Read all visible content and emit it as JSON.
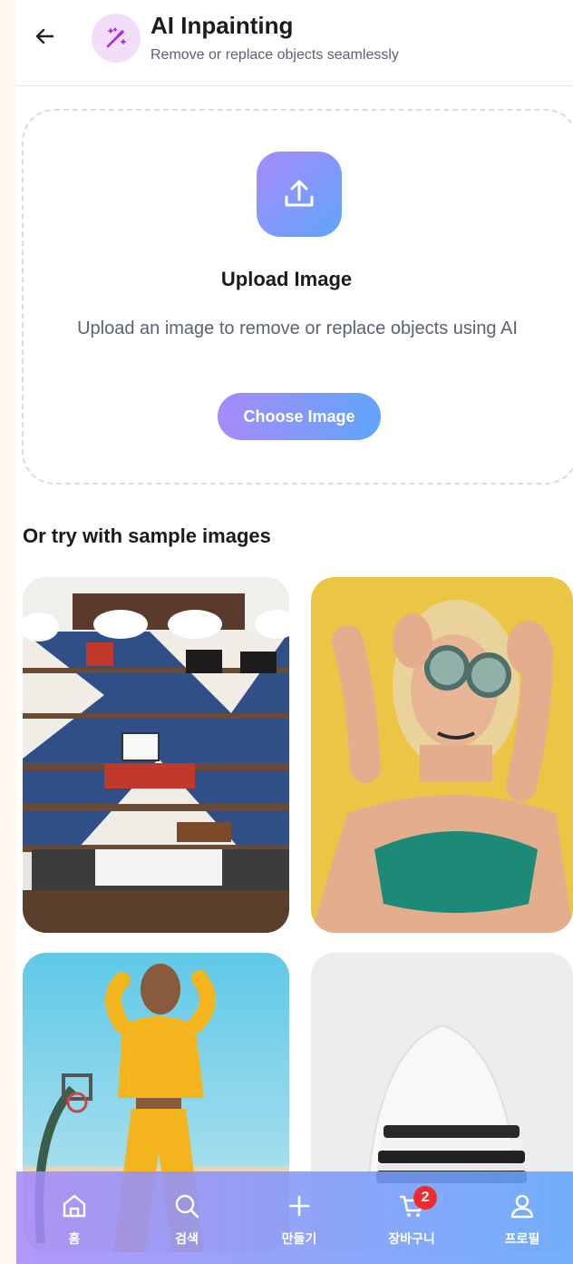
{
  "header": {
    "back_icon": "arrow-left-icon",
    "feature_icon": "magic-wand-icon",
    "title": "AI Inpainting",
    "subtitle": "Remove or replace objects seamlessly"
  },
  "upload": {
    "icon": "upload-icon",
    "title": "Upload Image",
    "description": "Upload an image to remove or replace objects using AI",
    "button_label": "Choose Image"
  },
  "samples": {
    "title": "Or try with sample images",
    "items": [
      {
        "subject": "clothing store shelves"
      },
      {
        "subject": "woman with round sunglasses"
      },
      {
        "subject": "woman in yellow tracksuit"
      },
      {
        "subject": "folded clothes on white chair"
      }
    ]
  },
  "nav": {
    "items": [
      {
        "label": "홈",
        "icon": "home-icon"
      },
      {
        "label": "검색",
        "icon": "search-icon"
      },
      {
        "label": "만들기",
        "icon": "plus-icon"
      },
      {
        "label": "장바구니",
        "icon": "cart-icon",
        "badge": "2"
      },
      {
        "label": "프로필",
        "icon": "user-icon"
      }
    ]
  },
  "colors": {
    "accent_start": "#a78bfa",
    "accent_end": "#60a5fa",
    "badge": "#ef2b2b"
  }
}
